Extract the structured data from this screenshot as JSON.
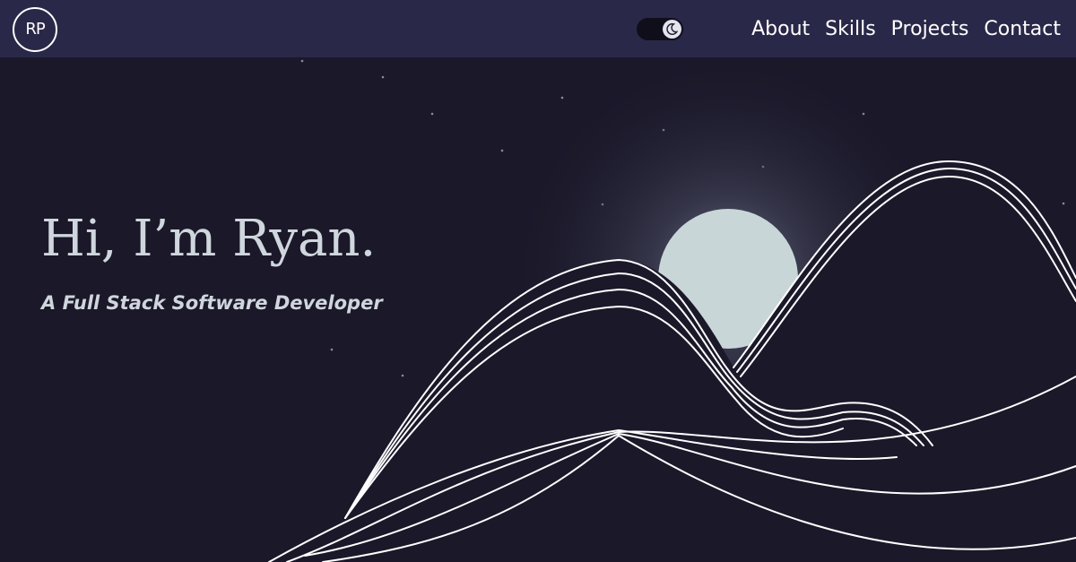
{
  "header": {
    "logo_text": "RP",
    "theme_toggle": {
      "icon": "moon-icon",
      "mode": "dark"
    },
    "nav": [
      {
        "label": "About"
      },
      {
        "label": "Skills"
      },
      {
        "label": "Projects"
      },
      {
        "label": "Contact"
      }
    ]
  },
  "hero": {
    "title": "Hi, I’m Ryan.",
    "subtitle": "A Full Stack Software Developer"
  },
  "colors": {
    "background": "#1a1829",
    "navbar": "#2a2848",
    "text": "#cfd6dd",
    "moon": "#c9d6d8",
    "lines": "#ffffff"
  }
}
